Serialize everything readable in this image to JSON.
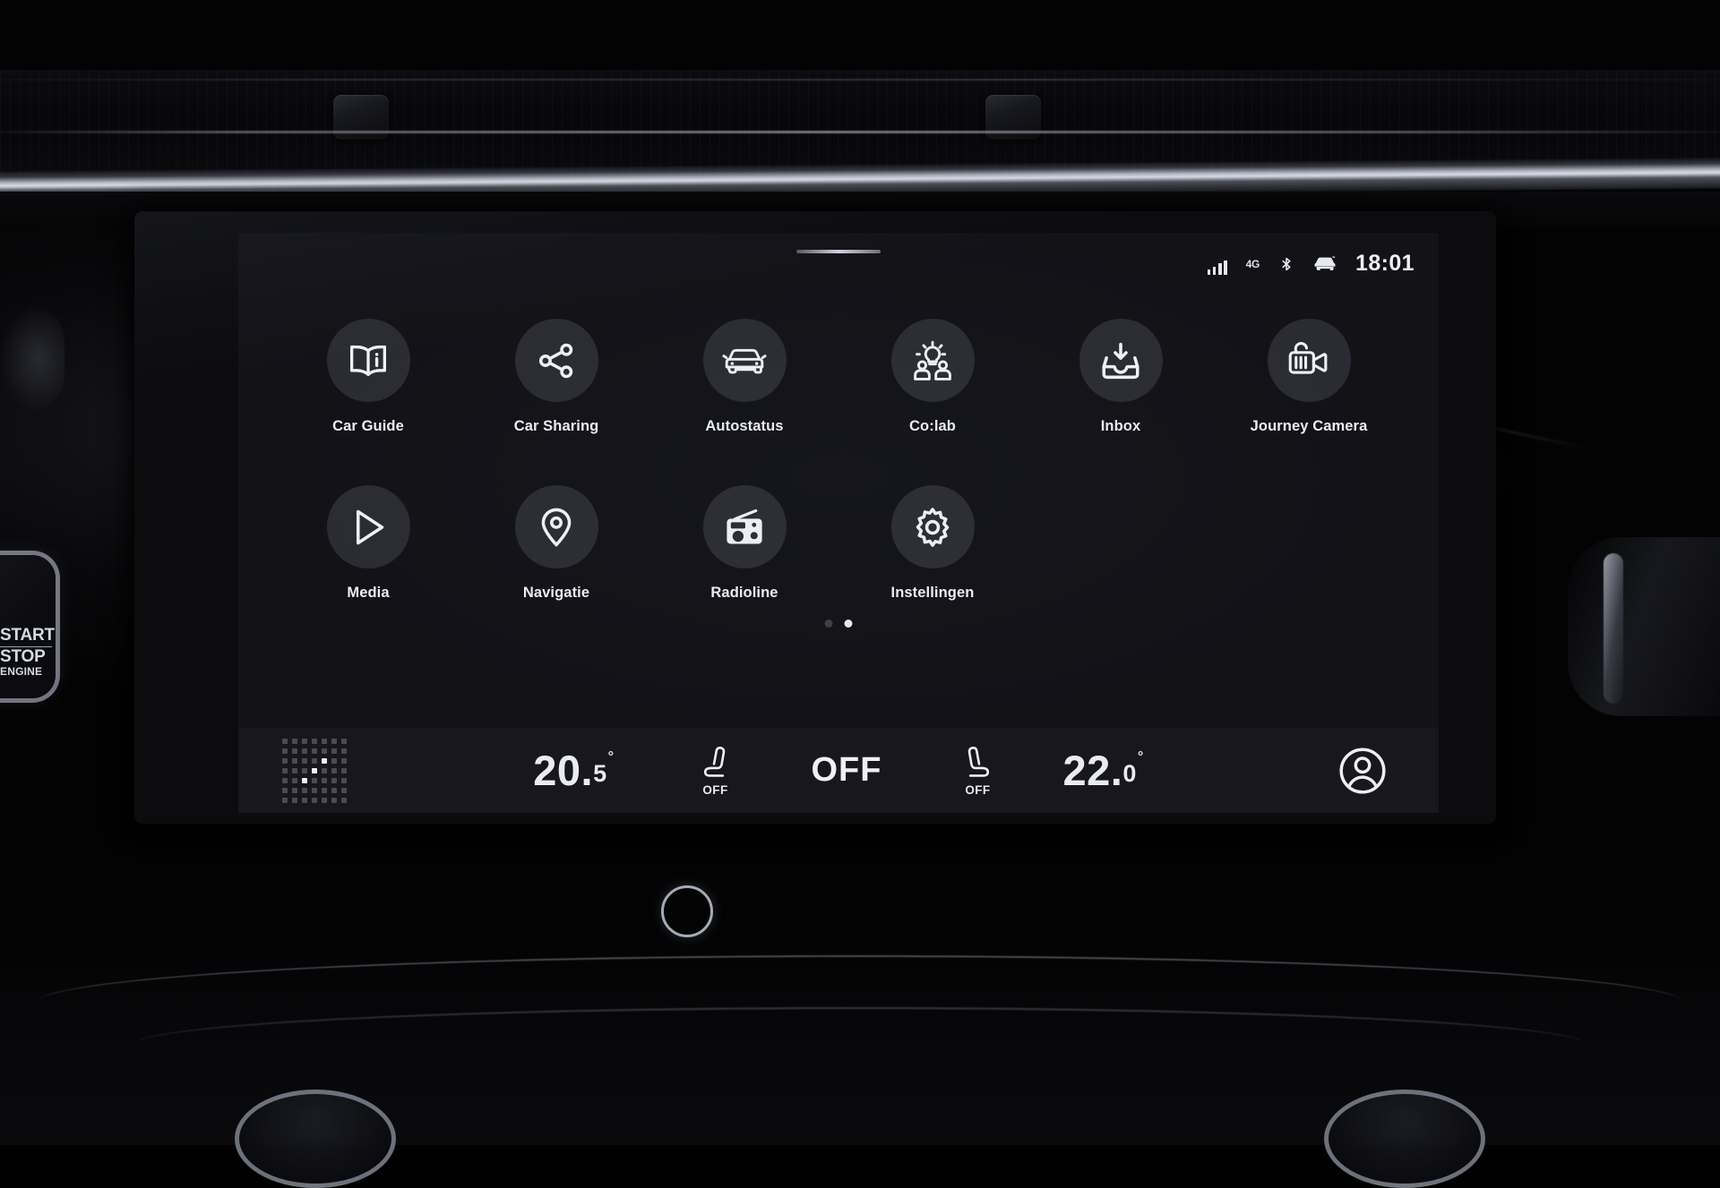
{
  "vehicle": {
    "start_button_line1": "START",
    "start_button_line2": "STOP",
    "start_button_line3": "ENGINE"
  },
  "statusbar": {
    "signal_icon": "signal-bars-icon",
    "network": "4G",
    "bluetooth_icon": "bluetooth-icon",
    "car_icon": "car-status-icon",
    "clock": "18:01"
  },
  "home": {
    "pull_handle": "pull-down-handle",
    "apps": [
      {
        "label": "Car Guide",
        "icon": "book-info-icon"
      },
      {
        "label": "Car Sharing",
        "icon": "share-nodes-icon"
      },
      {
        "label": "Autostatus",
        "icon": "car-front-icon"
      },
      {
        "label": "Co:lab",
        "icon": "lightbulb-people-icon"
      },
      {
        "label": "Inbox",
        "icon": "inbox-download-icon"
      },
      {
        "label": "Journey Camera",
        "icon": "video-camera-icon"
      },
      {
        "label": "Media",
        "icon": "play-triangle-icon"
      },
      {
        "label": "Navigatie",
        "icon": "location-pin-icon"
      },
      {
        "label": "Radioline",
        "icon": "radio-icon"
      },
      {
        "label": "Instellingen",
        "icon": "gear-icon"
      }
    ],
    "pages": {
      "count": 2,
      "active_index": 1
    }
  },
  "climate": {
    "launcher_icon": "app-launcher-dot-grid-icon",
    "left_temp_whole": "20",
    "left_temp_sep": ".",
    "left_temp_frac": "5",
    "left_temp_degree": "°",
    "left_seat_icon": "heated-seat-left-icon",
    "left_seat_status": "OFF",
    "fan_status": "OFF",
    "right_seat_icon": "heated-seat-right-icon",
    "right_seat_status": "OFF",
    "right_temp_whole": "22",
    "right_temp_sep": ".",
    "right_temp_frac": "0",
    "right_temp_degree": "°",
    "profile_icon": "user-profile-icon"
  },
  "colors": {
    "screen_bg": "#121217",
    "climate_bar_bg": "#17171d",
    "app_circle_bg": "#2b2c33",
    "text_primary": "#eceef4",
    "dot_inactive": "#3c3d46",
    "dot_active": "#e6e8f0"
  }
}
